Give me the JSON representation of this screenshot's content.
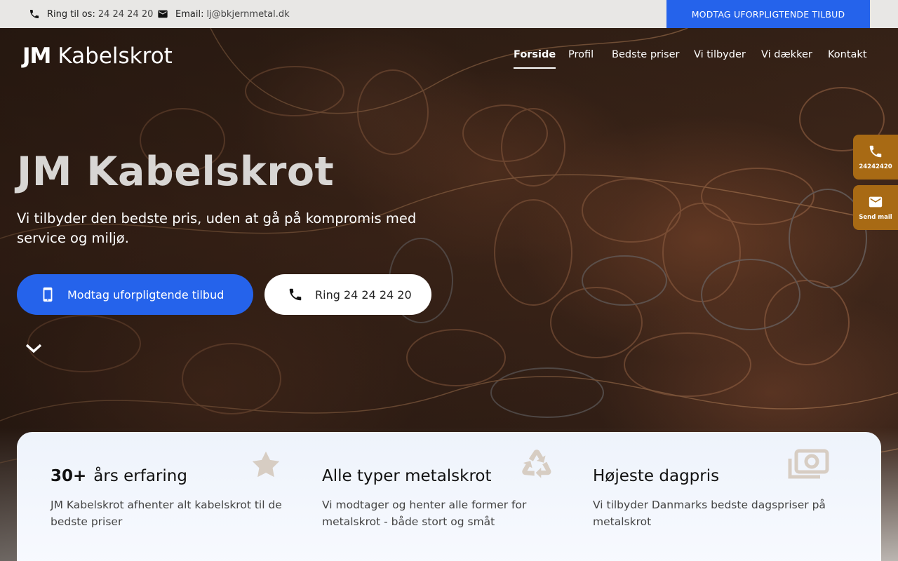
{
  "topbar": {
    "phone_label": "Ring til os:",
    "phone_value": "24 24 24 20",
    "email_label": "Email:",
    "email_value": "lj@bkjernmetal.dk",
    "cta": "MODTAG UFORPLIGTENDE TILBUD"
  },
  "header": {
    "logo_jm": "JM",
    "logo_text": "Kabelskrot",
    "nav": [
      "Forside",
      "Profil",
      "Bedste priser",
      "Vi tilbyder",
      "Vi dækker",
      "Kontakt"
    ]
  },
  "hero": {
    "title": "JM Kabelskrot",
    "subtitle": "Vi tilbyder den bedste pris, uden at gå på kompromis med service og miljø.",
    "btn_primary": "Modtag uforpligtende tilbud",
    "btn_secondary": "Ring 24 24 24 20"
  },
  "side": {
    "phone": "24242420",
    "mail": "Send mail"
  },
  "features": [
    {
      "num": "30+",
      "title": "års erfaring",
      "text": "JM Kabelskrot afhenter alt kabelskrot til de bedste priser",
      "icon": "star-icon"
    },
    {
      "num": "",
      "title": "Alle typer metalskrot",
      "text": "Vi modtager og henter alle former for metalskrot - både stort og småt",
      "icon": "recycle-icon"
    },
    {
      "num": "",
      "title": "Højeste dagpris",
      "text": "Vi tilbyder Danmarks bedste dagspriser på metalskrot",
      "icon": "money-icon"
    }
  ],
  "colors": {
    "accent_blue": "#2563eb",
    "side_widget": "#a86a14",
    "feature_icon": "#d7cdc3"
  }
}
